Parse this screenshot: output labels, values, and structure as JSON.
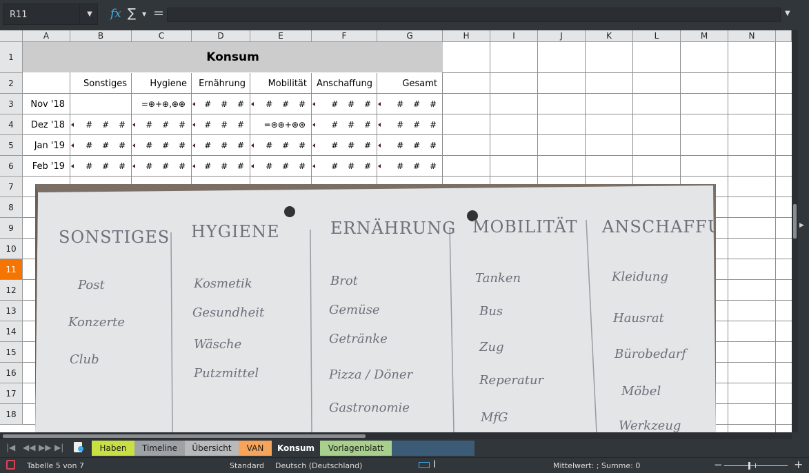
{
  "name_box": {
    "value": "R11"
  },
  "formula": {
    "value": ""
  },
  "columns": [
    "A",
    "B",
    "C",
    "D",
    "E",
    "F",
    "G",
    "H",
    "I",
    "J",
    "K",
    "L",
    "M",
    "N"
  ],
  "rows": [
    "1",
    "2",
    "3",
    "4",
    "5",
    "6",
    "7",
    "8",
    "9",
    "10",
    "11",
    "12",
    "13",
    "14",
    "15",
    "16",
    "17",
    "18"
  ],
  "selected_row": "11",
  "sheet": {
    "title": "Konsum",
    "headers": [
      "Sonstiges",
      "Hygiene",
      "Ernährung",
      "Mobilität",
      "Anschaffung",
      "Gesamt"
    ],
    "row_labels": [
      "Nov '18",
      "Dez '18",
      "Jan '19",
      "Feb '19"
    ],
    "hash": "# # #",
    "formula_glyph_c3": "=⊕+⊕,⊕⊕",
    "formula_glyph_e4": "=⊛⊕+⊕⊛"
  },
  "photo": {
    "columns": [
      {
        "heading": "SONSTIGES",
        "items": [
          "Post",
          "Konzerte",
          "Club"
        ]
      },
      {
        "heading": "HYGIENE",
        "items": [
          "Kosmetik",
          "Gesundheit",
          "Wäsche",
          "Putzmittel"
        ]
      },
      {
        "heading": "ERNÄHRUNG",
        "items": [
          "Brot",
          "Gemüse",
          "Getränke",
          "Pizza / Döner",
          "Gastronomie"
        ]
      },
      {
        "heading": "MOBILITÄT",
        "items": [
          "Tanken",
          "Bus",
          "Zug",
          "Reperatur",
          "MfG"
        ]
      },
      {
        "heading": "ANSCHAFFUNG",
        "items": [
          "Kleidung",
          "Hausrat",
          "Bürobedarf",
          "Möbel",
          "Werkzeug"
        ]
      }
    ]
  },
  "tabs": [
    {
      "label": "Haben",
      "color": "#c9e044",
      "active": false
    },
    {
      "label": "Timeline",
      "color": "#9ea2a6",
      "active": false
    },
    {
      "label": "Übersicht",
      "color": "#b7b9bb",
      "active": false
    },
    {
      "label": "VAN",
      "color": "#f6a45a",
      "active": false
    },
    {
      "label": "Konsum",
      "color": "#31363b",
      "active": true
    },
    {
      "label": "Vorlagenblatt",
      "color": "#a8cf8c",
      "active": false
    }
  ],
  "status": {
    "sheet_info": "Tabelle 5 von 7",
    "page_style": "Standard",
    "language": "Deutsch (Deutschland)",
    "summary": "Mittelwert: ; Summe: 0"
  },
  "icons": {
    "fx": "fx",
    "sigma": "∑",
    "equals": "="
  }
}
